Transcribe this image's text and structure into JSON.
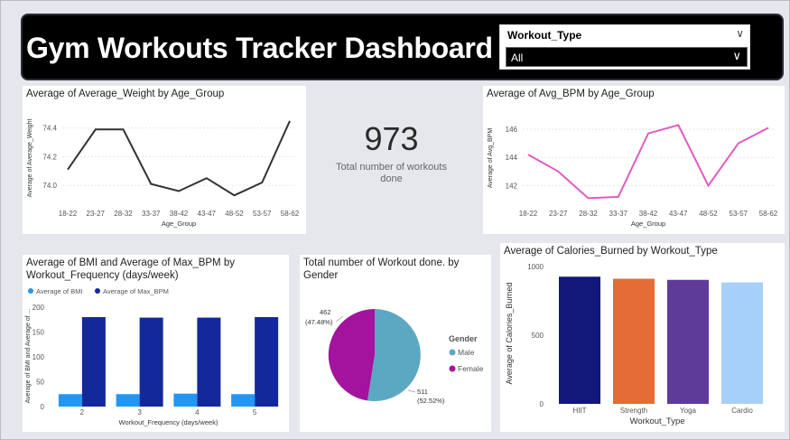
{
  "header": {
    "title": "Gym Workouts Tracker Dashboard",
    "slicer_label": "Workout_Type",
    "slicer_value": "All"
  },
  "kpi": {
    "value": "973",
    "label": "Total number of workouts done"
  },
  "colors": {
    "weight_line": "#333333",
    "bpm_line": "#e05bc0",
    "bmi_bar": "#2196f3",
    "max_bpm_bar": "#13289a",
    "pie_male": "#5ca8c2",
    "pie_female": "#a3139e",
    "hiit": "#12187a",
    "strength": "#e56c35",
    "yoga": "#5e3a99",
    "cardio": "#a6d0fa"
  },
  "chart_data": [
    {
      "id": "weight",
      "type": "line",
      "title": "Average of Average_Weight by Age_Group",
      "xlabel": "Age_Group",
      "ylabel": "Average of Average_Weight",
      "categories": [
        "18-22",
        "23-27",
        "28-32",
        "33-37",
        "38-42",
        "43-47",
        "48-52",
        "53-57",
        "58-62"
      ],
      "values": [
        74.11,
        74.39,
        74.39,
        74.01,
        73.96,
        74.05,
        73.93,
        74.02,
        74.45
      ],
      "yticks": [
        "74.0",
        "74.2",
        "74.4"
      ],
      "ylim": [
        73.9,
        74.48
      ]
    },
    {
      "id": "bpm",
      "type": "line",
      "title": "Average of Avg_BPM by Age_Group",
      "xlabel": "Age_Group",
      "ylabel": "Average of Avg_BPM",
      "categories": [
        "18-22",
        "23-27",
        "28-32",
        "33-37",
        "38-42",
        "43-47",
        "48-52",
        "53-57",
        "58-62"
      ],
      "values": [
        144.2,
        143.0,
        141.1,
        141.2,
        145.7,
        146.3,
        142.0,
        145.0,
        146.1
      ],
      "yticks": [
        "142",
        "144",
        "146"
      ],
      "ylim": [
        141.0,
        146.9
      ]
    },
    {
      "id": "bmi",
      "type": "bar",
      "title_line1": "Average of BMI and Average of Max_BPM by",
      "title_line2": "Workout_Frequency (days/week)",
      "xlabel": "Workout_Frequency (days/week)",
      "ylabel": "Average of BMI and Average of ...",
      "categories": [
        "2",
        "3",
        "4",
        "5"
      ],
      "series": [
        {
          "name": "Average of BMI",
          "values": [
            25,
            25,
            26,
            25
          ]
        },
        {
          "name": "Average of Max_BPM",
          "values": [
            180,
            179,
            179,
            180
          ]
        }
      ],
      "yticks": [
        "0",
        "50",
        "100",
        "150",
        "200"
      ],
      "ylim": [
        0,
        200
      ]
    },
    {
      "id": "gender",
      "type": "pie",
      "title_line1": "Total number of Workout done. by",
      "title_line2": "Gender",
      "legend_title": "Gender",
      "slices": [
        {
          "name": "Male",
          "value": 511,
          "label_top": "511",
          "label_bottom": "(52.52%)"
        },
        {
          "name": "Female",
          "value": 462,
          "label_top": "462",
          "label_bottom": "(47.48%)"
        }
      ]
    },
    {
      "id": "calories",
      "type": "bar",
      "title": "Average of Calories_Burned by Workout_Type",
      "xlabel": "Workout_Type",
      "ylabel": "Average of Calories_Burned",
      "categories": [
        "HIIT",
        "Strength",
        "Yoga",
        "Cardio"
      ],
      "values": [
        926,
        911,
        903,
        884
      ],
      "yticks": [
        "0",
        "500",
        "1000"
      ],
      "ylim": [
        0,
        1000
      ]
    }
  ]
}
